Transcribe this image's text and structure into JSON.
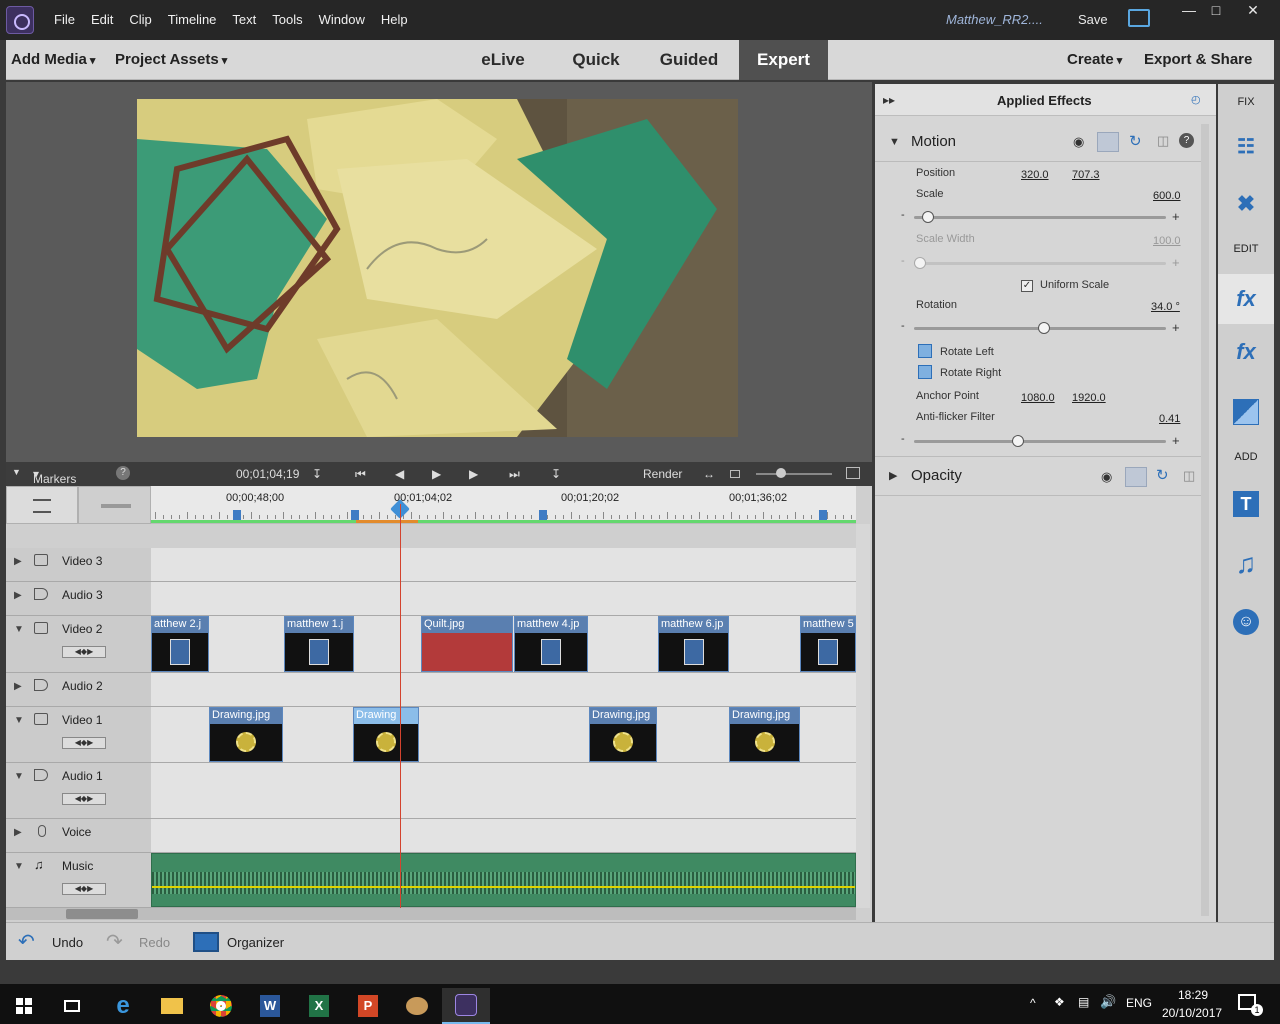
{
  "menubar": {
    "items": [
      "File",
      "Edit",
      "Clip",
      "Timeline",
      "Text",
      "Tools",
      "Window",
      "Help"
    ],
    "project_name": "Matthew_RR2....",
    "save_label": "Save",
    "window_controls": [
      "—",
      "□",
      "✕"
    ]
  },
  "modebar": {
    "add_media": "Add Media",
    "project_assets": "Project Assets",
    "tabs": [
      "eLive",
      "Quick",
      "Guided",
      "Expert"
    ],
    "active_tab": "Expert",
    "create": "Create",
    "export_share": "Export & Share"
  },
  "transport": {
    "markers": "Markers",
    "help": "?",
    "timecode": "00;01;04;19",
    "render": "Render"
  },
  "timeline": {
    "ruler_labels": [
      "00;00;48;00",
      "00;01;04;02",
      "00;01;20;02",
      "00;01;36;02"
    ],
    "tracks": [
      {
        "name": "Video 3",
        "icon": "film-icon"
      },
      {
        "name": "Audio 3",
        "icon": "speaker-icon"
      },
      {
        "name": "Video 2",
        "icon": "film-icon"
      },
      {
        "name": "Audio 2",
        "icon": "speaker-icon"
      },
      {
        "name": "Video 1",
        "icon": "film-icon"
      },
      {
        "name": "Audio 1",
        "icon": "speaker-icon"
      },
      {
        "name": "Voice",
        "icon": "mic-icon"
      },
      {
        "name": "Music",
        "icon": "music-note-icon"
      }
    ],
    "video2_clips": [
      "atthew 2.j",
      "matthew 1.j",
      "Quilt.jpg",
      "matthew 4.jp",
      "matthew 6.jp",
      "matthew 5"
    ],
    "video1_clips": [
      "Drawing.jpg",
      "Drawing",
      "Drawing.jpg",
      "Drawing.jpg"
    ]
  },
  "effects": {
    "title": "Applied Effects",
    "motion": {
      "label": "Motion",
      "position_label": "Position",
      "position_x": "320.0",
      "position_y": "707.3",
      "scale_label": "Scale",
      "scale_value": "600.0",
      "scale_level": 0.03,
      "scale_width_label": "Scale Width",
      "scale_width_value": "100.0",
      "uniform_scale_label": "Uniform Scale",
      "uniform_scale_checked": true,
      "rotation_label": "Rotation",
      "rotation_value": "34.0 °",
      "rotate_left": "Rotate Left",
      "rotate_right": "Rotate Right",
      "anchor_label": "Anchor Point",
      "anchor_x": "1080.0",
      "anchor_y": "1920.0",
      "antiflicker_label": "Anti-flicker Filter",
      "antiflicker_value": "0.41"
    },
    "opacity": {
      "label": "Opacity"
    }
  },
  "sidebar": {
    "fix": "FIX",
    "edit": "EDIT",
    "add": "ADD",
    "fx_text": "fx",
    "title_text": "T"
  },
  "bottombar": {
    "undo": "Undo",
    "redo": "Redo",
    "organizer": "Organizer"
  },
  "taskbar": {
    "lang": "ENG",
    "time": "18:29",
    "date": "20/10/2017",
    "notif_count": "1"
  },
  "colors": {
    "accent": "#2d6fb8",
    "playhead": "#d3432e",
    "clip_header": "#5a7fb0",
    "music_track": "#3f8a62"
  }
}
